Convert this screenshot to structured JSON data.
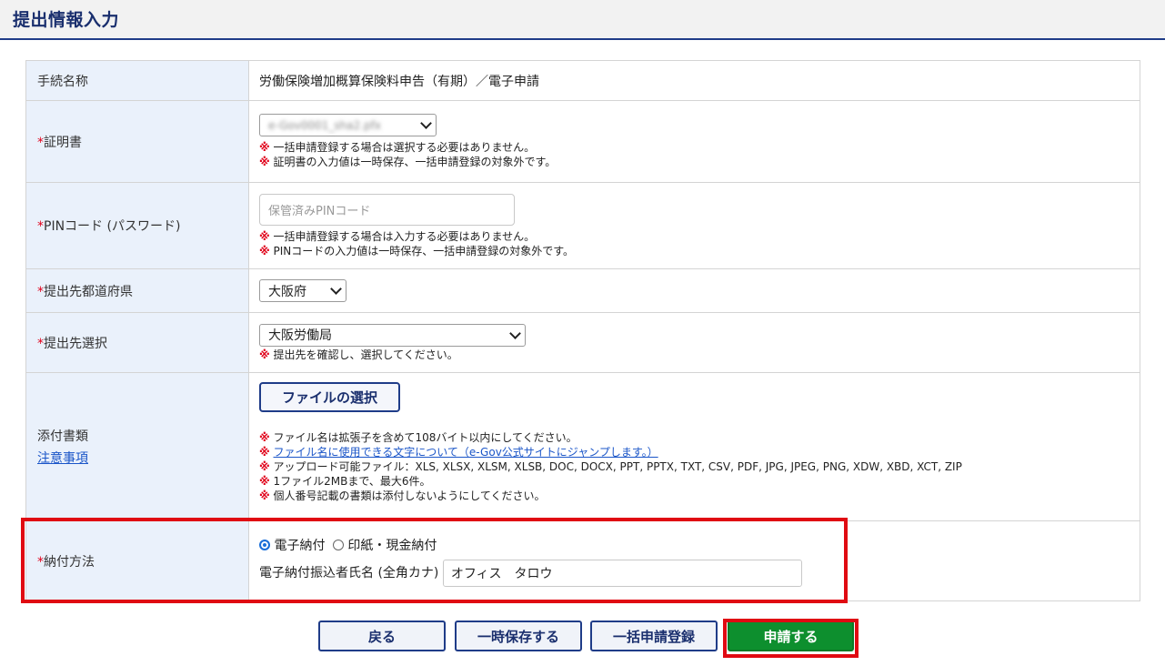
{
  "header": {
    "title": "提出情報入力"
  },
  "form": {
    "procedure": {
      "label": "手続名称",
      "value": "労働保険増加概算保険料申告（有期）／電子申請"
    },
    "certificate": {
      "required_mark": "*",
      "label": "証明書",
      "selected": "e-Gov0001_sha2.pfx",
      "notes": [
        "一括申請登録する場合は選択する必要はありません。",
        "証明書の入力値は一時保存、一括申請登録の対象外です。"
      ]
    },
    "pin": {
      "required_mark": "*",
      "label": "PINコード (パスワード)",
      "placeholder": "保管済みPINコード",
      "notes": [
        "一括申請登録する場合は入力する必要はありません。",
        "PINコードの入力値は一時保存、一括申請登録の対象外です。"
      ]
    },
    "prefecture": {
      "required_mark": "*",
      "label": "提出先都道府県",
      "selected": "大阪府"
    },
    "destination": {
      "required_mark": "*",
      "label": "提出先選択",
      "selected": "大阪労働局",
      "note": "提出先を確認し、選択してください。"
    },
    "attachments": {
      "label": "添付書類",
      "link": "注意事項",
      "file_button": "ファイルの選択",
      "notes": [
        "ファイル名は拡張子を含めて108バイト以内にしてください。",
        "ファイル名に使用できる文字について（e-Gov公式サイトにジャンプします。）",
        "アップロード可能ファイル：XLS, XLSX, XLSM, XLSB, DOC, DOCX, PPT, PPTX, TXT, CSV, PDF, JPG, JPEG, PNG, XDW, XBD, XCT, ZIP",
        "1ファイル2MBまで、最大6件。",
        "個人番号記載の書類は添付しないようにしてください。"
      ]
    },
    "payment": {
      "required_mark": "*",
      "label": "納付方法",
      "options": [
        "電子納付",
        "印紙・現金納付"
      ],
      "selected_index": 0,
      "payer_label": "電子納付振込者氏名 (全角カナ)",
      "payer_value": "オフィス　タロウ"
    },
    "note_mark": "※"
  },
  "buttons": {
    "back": "戻る",
    "save": "一時保存する",
    "bulk": "一括申請登録",
    "submit": "申請する"
  },
  "colors": {
    "highlight": "#e00a12",
    "submit": "#0d8f2e",
    "navy": "#1f3c88"
  }
}
